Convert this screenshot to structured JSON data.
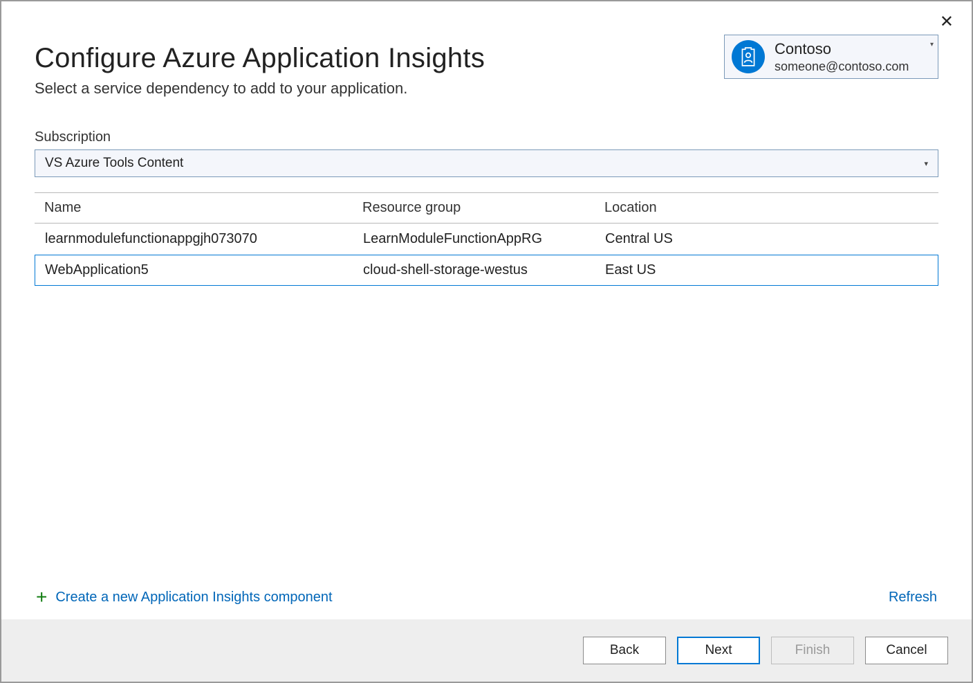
{
  "header": {
    "title": "Configure Azure Application Insights",
    "subtitle": "Select a service dependency to add to your application."
  },
  "account": {
    "name": "Contoso",
    "email": "someone@contoso.com"
  },
  "subscription": {
    "label": "Subscription",
    "selected": "VS Azure Tools Content"
  },
  "table": {
    "columns": {
      "name": "Name",
      "rg": "Resource group",
      "loc": "Location"
    },
    "rows": [
      {
        "name": "learnmodulefunctionappgjh073070",
        "rg": "LearnModuleFunctionAppRG",
        "loc": "Central US",
        "selected": false
      },
      {
        "name": "WebApplication5",
        "rg": "cloud-shell-storage-westus",
        "loc": "East US",
        "selected": true
      }
    ]
  },
  "links": {
    "create": "Create a new Application Insights component",
    "refresh": "Refresh"
  },
  "buttons": {
    "back": "Back",
    "next": "Next",
    "finish": "Finish",
    "cancel": "Cancel"
  }
}
